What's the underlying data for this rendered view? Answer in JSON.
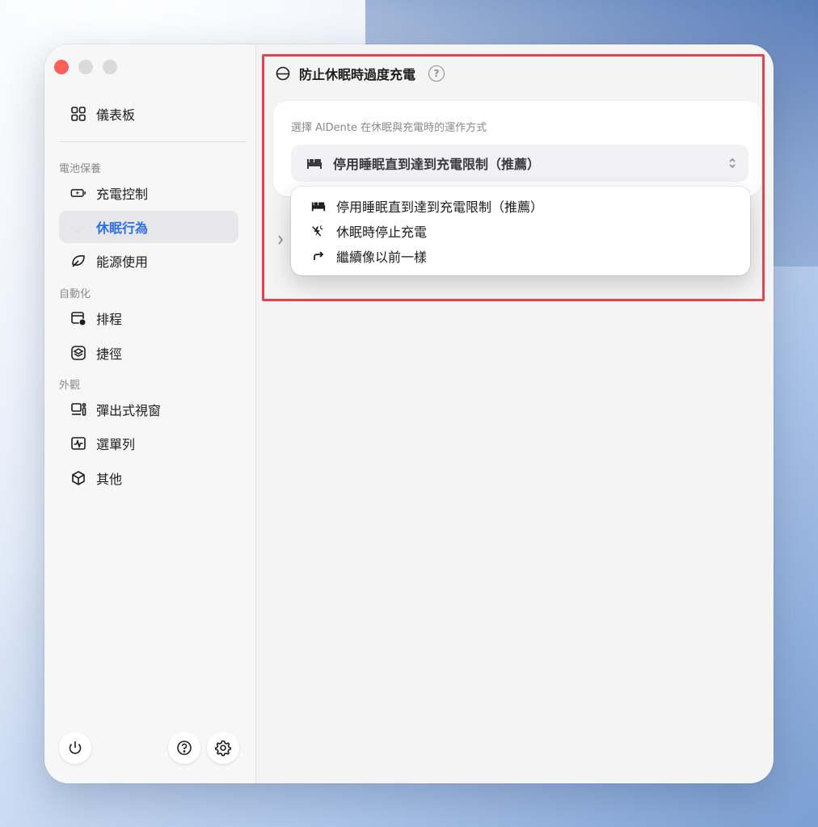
{
  "sidebar": {
    "dashboard": "儀表板",
    "sections": [
      {
        "label": "電池保養",
        "items": [
          {
            "label": "充電控制",
            "icon": "battery-charge-icon"
          },
          {
            "label": "休眠行為",
            "icon": "moon-icon",
            "active": true
          },
          {
            "label": "能源使用",
            "icon": "leaf-icon"
          }
        ]
      },
      {
        "label": "自動化",
        "items": [
          {
            "label": "排程",
            "icon": "calendar-clock-icon"
          },
          {
            "label": "捷徑",
            "icon": "shortcuts-icon"
          }
        ]
      },
      {
        "label": "外觀",
        "items": [
          {
            "label": "彈出式視窗",
            "icon": "popup-window-icon"
          },
          {
            "label": "選單列",
            "icon": "menubar-chart-icon"
          },
          {
            "label": "其他",
            "icon": "cube-icon"
          }
        ]
      }
    ]
  },
  "main": {
    "title": "防止休眠時過度充電",
    "help": "?",
    "card": {
      "description": "選擇 AlDente 在休眠與充電時的運作方式",
      "selected": "停用睡眠直到達到充電限制（推薦）"
    },
    "menu": {
      "options": [
        {
          "label": "停用睡眠直到達到充電限制（推薦）",
          "icon": "bed-icon"
        },
        {
          "label": "休眠時停止充電",
          "icon": "no-charge-sleep-icon"
        },
        {
          "label": "繼續像以前一樣",
          "icon": "redo-arrow-icon"
        }
      ]
    }
  },
  "colors": {
    "accent": "#2f6fe4",
    "highlight": "#e2434e",
    "close": "#fe5f57"
  }
}
